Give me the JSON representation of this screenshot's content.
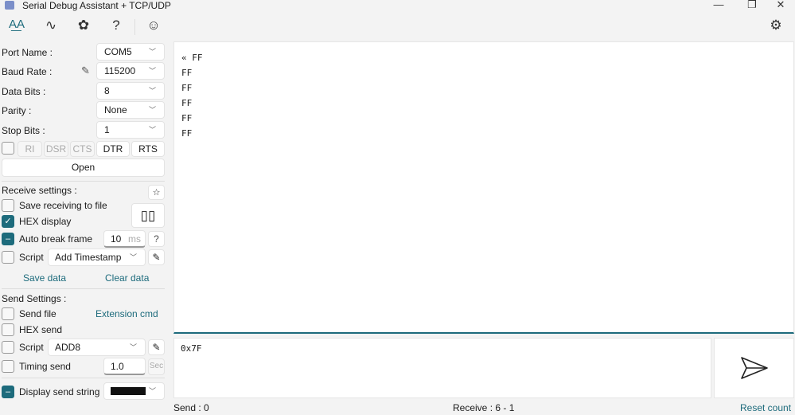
{
  "window": {
    "title": "Serial Debug Assistant + TCP/UDP",
    "minimize": "—",
    "restore": "❐",
    "close": "✕"
  },
  "toolbar": {
    "text": "A͟A",
    "wave": "∿",
    "plugin": "✿",
    "help": "?",
    "emoji": "☺",
    "settings": "⚙"
  },
  "serial": {
    "port_label": "Port Name :",
    "port": "COM5",
    "baud_label": "Baud Rate :",
    "baud": "115200",
    "data_label": "Data Bits :",
    "data": "8",
    "parity_label": "Parity :",
    "parity": "None",
    "stop_label": "Stop Bits :",
    "stop": "1",
    "ri": "RI",
    "dsr": "DSR",
    "cts": "CTS",
    "dtr": "DTR",
    "rts": "RTS",
    "open": "Open"
  },
  "receive": {
    "title": "Receive settings :",
    "save_file": "Save receiving to file",
    "hex_display": "HEX display",
    "auto_break": "Auto break frame",
    "break_value": "10",
    "break_unit": "ms",
    "help": "?",
    "script": "Script",
    "script_value": "Add Timestamp",
    "pause": "▯▯",
    "save_data": "Save data",
    "clear_data": "Clear data"
  },
  "send_settings": {
    "title": "Send Settings :",
    "send_file": "Send file",
    "extension": "Extension cmd",
    "hex_send": "HEX send",
    "script": "Script",
    "script_value": "ADD8",
    "timing": "Timing send",
    "timing_value": "1.0",
    "timing_unit": "Sec",
    "display_string": "Display send string"
  },
  "receive_area": {
    "lines": [
      "« FF",
      "FF",
      "FF",
      "FF",
      "FF",
      "FF"
    ]
  },
  "send_area": {
    "value": "0x7F"
  },
  "status": {
    "send": "Send :  0",
    "receive": "Receive :  6  -  1",
    "reset": "Reset count"
  }
}
